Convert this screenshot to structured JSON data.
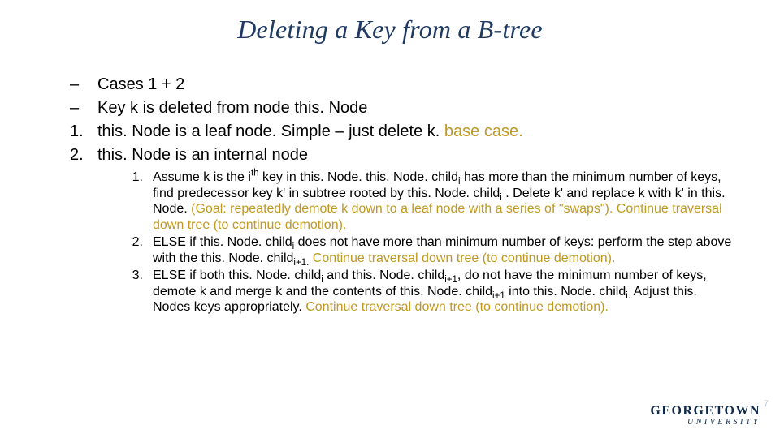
{
  "title": "Deleting a Key from a B-tree",
  "main": [
    {
      "marker": "–",
      "pre": "Cases 1 + 2",
      "hi": "",
      "post": ""
    },
    {
      "marker": "–",
      "pre": "Key k is deleted from node this. Node",
      "hi": "",
      "post": ""
    },
    {
      "marker": "1.",
      "pre": "this. Node is a leaf node. Simple – just delete k. ",
      "hi": "base case.",
      "post": ""
    },
    {
      "marker": "2.",
      "pre": "this. Node is an internal node",
      "hi": "",
      "post": ""
    }
  ],
  "sub": [
    {
      "marker": "1.",
      "pre_html": "Assume k is the i<sup>th</sup> key in this. Node. this. Node. child<sub>i</sub> has more than the minimum number of keys, find predecessor key k' in subtree rooted by this. Node. child<sub>i</sub> . Delete k'  and replace k with k' in this. Node. ",
      "hi": "(Goal: repeatedly demote k down to a leaf node with a series of \"swaps\"). Continue traversal down tree (to continue demotion).",
      "post_html": ""
    },
    {
      "marker": "2.",
      "pre_html": "ELSE if this. Node. child<sub>i</sub> does not have more than minimum number of keys: perform the step above with the this. Node. child<sub>i+1.</sub> ",
      "hi": "Continue traversal down tree (to continue demotion).",
      "post_html": ""
    },
    {
      "marker": "3.",
      "pre_html": "ELSE if both this. Node. child<sub>i</sub> and this. Node. child<sub>i+1</sub>, do not have the minimum number of keys, demote k and merge k and the contents of this. Node. child<sub>i+1</sub> into this. Node. child<sub>i.</sub> Adjust this. Nodes keys appropriately. ",
      "hi": "Continue traversal down tree (to continue demotion).",
      "post_html": ""
    }
  ],
  "logo": {
    "line1": "GEORGETOWN",
    "line2": "UNIVERSITY"
  },
  "slide_number": "7"
}
